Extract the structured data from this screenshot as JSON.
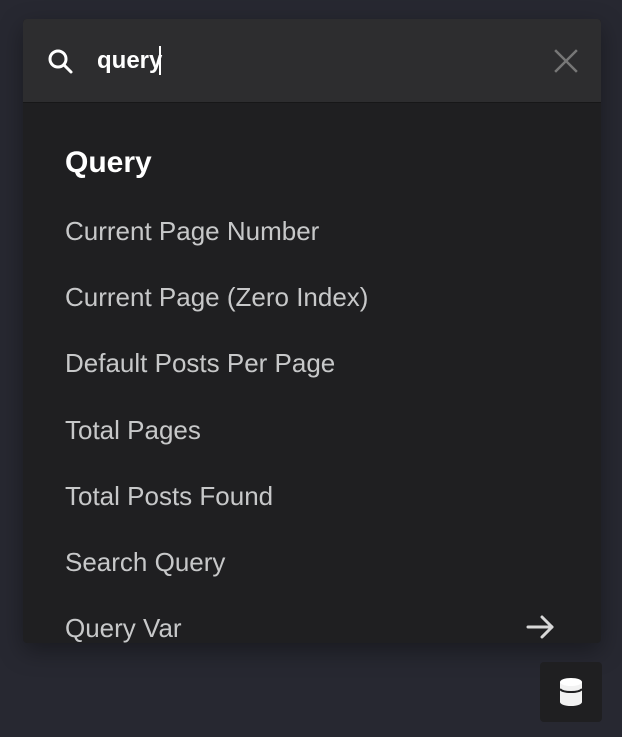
{
  "search": {
    "value": "query",
    "icon": "search-icon",
    "clear_icon": "close-icon"
  },
  "results": {
    "section_title": "Query",
    "items": [
      {
        "label": "Current Page Number"
      },
      {
        "label": "Current Page (Zero Index)"
      },
      {
        "label": "Default Posts Per Page"
      },
      {
        "label": "Total Pages"
      },
      {
        "label": "Total Posts Found"
      },
      {
        "label": "Search Query"
      },
      {
        "label": "Query Var",
        "icon": "arrow-right-icon"
      }
    ]
  },
  "floating_button": {
    "icon": "database-icon"
  },
  "colors": {
    "page_background": "#272831",
    "panel_background": "#1f1f21",
    "search_background": "#2d2d2f",
    "title_text": "#ffffff",
    "item_text": "#c7c8c9",
    "icon_color": "#d8d8d8"
  }
}
